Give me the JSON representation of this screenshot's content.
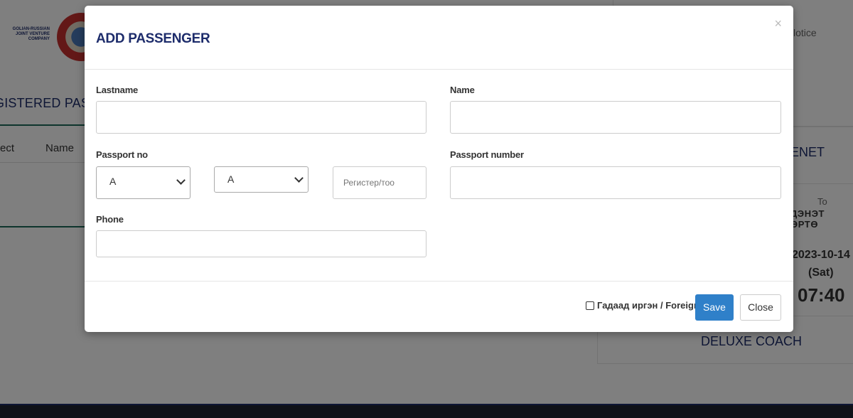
{
  "background": {
    "logo_lines": [
      "GOLIAN-RUSSIAN",
      "JOINT VENTURE",
      "COMPANY"
    ],
    "section_heading": "GISTERED PASSEN",
    "columns": [
      "ect",
      "Name"
    ],
    "notice_link": "lotice",
    "station_title": "ENET",
    "to_label": "To",
    "to_city": "ДЭНЭТ ӨРТӨ",
    "departure_date": "2023-10-14",
    "departure_day": "(Sat)",
    "departure_time": "07:40",
    "coach_class": "DELUXE COACH"
  },
  "modal": {
    "title": "ADD PASSENGER",
    "close_glyph": "×",
    "fields": {
      "lastname": {
        "label": "Lastname",
        "value": "",
        "placeholder": ""
      },
      "name": {
        "label": "Name",
        "value": "",
        "placeholder": ""
      },
      "passport_no": {
        "label": "Passport no",
        "letter1": "A",
        "letter2": "A",
        "register_placeholder": "Регистер/тоо"
      },
      "passport_number": {
        "label": "Passport number",
        "value": "",
        "placeholder": ""
      },
      "phone": {
        "label": "Phone",
        "value": "",
        "placeholder": ""
      }
    },
    "footer": {
      "foreigner_label": "Гадаад иргэн / Foreigner",
      "foreigner_checked": false,
      "save_label": "Save",
      "close_label": "Close"
    }
  },
  "colors": {
    "accent": "#1d2c6b",
    "primary_button": "#2f80c9",
    "overlay": "rgba(0,0,0,0.5)"
  }
}
